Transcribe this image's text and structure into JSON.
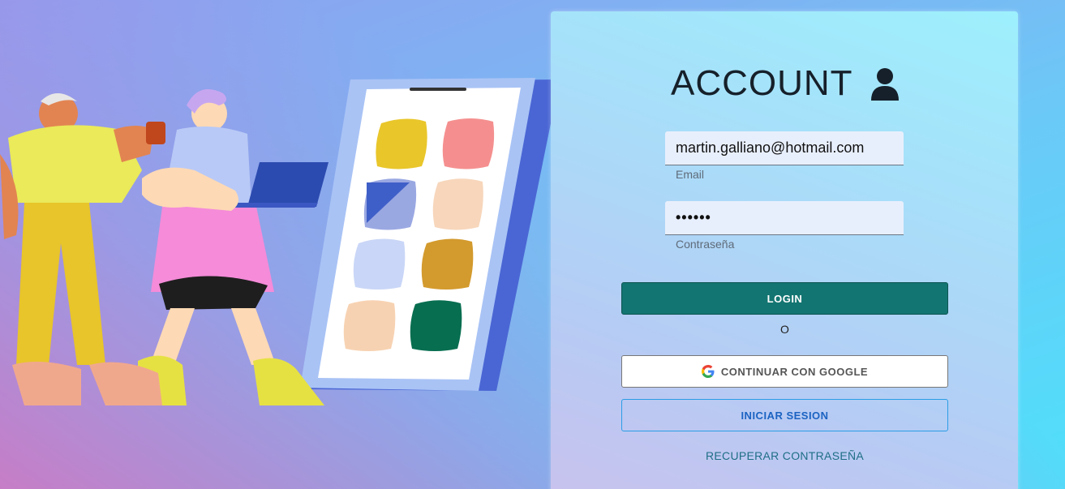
{
  "card": {
    "title": "ACCOUNT",
    "user_icon": "person-icon"
  },
  "email": {
    "value": "martin.galliano@hotmail.com",
    "label": "Email"
  },
  "password": {
    "value": "••••••",
    "label": "Contraseña"
  },
  "buttons": {
    "login": "LOGIN",
    "separator": "O",
    "google": "CONTINUAR CON GOOGLE",
    "google_icon": "google-icon",
    "signin": "INICIAR SESION",
    "recover": "RECUPERAR CONTRASEÑA"
  },
  "colors": {
    "login_bg": "#137571",
    "signin_text": "#1b63c2",
    "recover_text": "#1f6e86"
  }
}
